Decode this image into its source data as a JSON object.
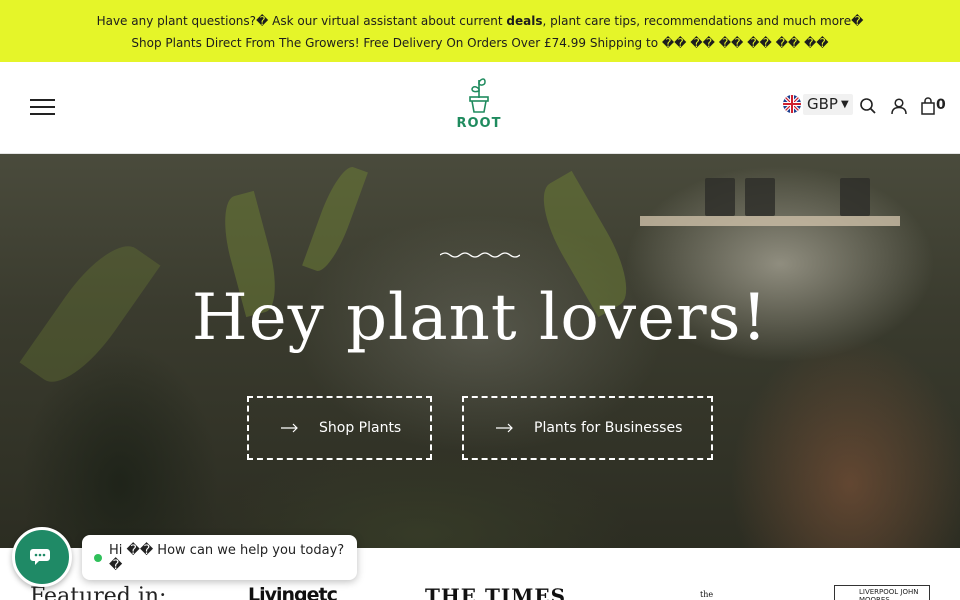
{
  "announcement": {
    "line1_before": "Have any plant questions?",
    "line1_icon": "�",
    "line1_mid": " Ask our virtual assistant about current ",
    "line1_bold": "deals",
    "line1_after": ", plant care tips, recommendations and much more",
    "line1_end_icon": "�",
    "line2": "Shop Plants Direct From The Growers! Free Delivery On Orders Over £74.99  Shipping to",
    "line2_flags": "�� �� �� �� �� ��"
  },
  "header": {
    "logo_text": "ROOT",
    "currency": "GBP",
    "cart_count": "0"
  },
  "hero": {
    "title": "Hey plant lovers!",
    "buttons": [
      {
        "label": "Shop Plants"
      },
      {
        "label": "Plants for Businesses"
      }
    ]
  },
  "featured": {
    "label": "Featured in:",
    "press": [
      "Livingetc",
      "THE TIMES",
      "the",
      "LIVERPOOL JOHN MOORES"
    ]
  },
  "chat": {
    "greeting": "Hi �� How can we help you today? �"
  },
  "colors": {
    "announcement_bg": "#e5f529",
    "brand_green": "#1f8b5e",
    "chat_green": "#1f8a66"
  },
  "icons": [
    "menu-icon",
    "plant-logo",
    "uk-flag-icon",
    "search-icon",
    "user-icon",
    "bag-icon",
    "arrow-right-icon",
    "chat-icon"
  ]
}
